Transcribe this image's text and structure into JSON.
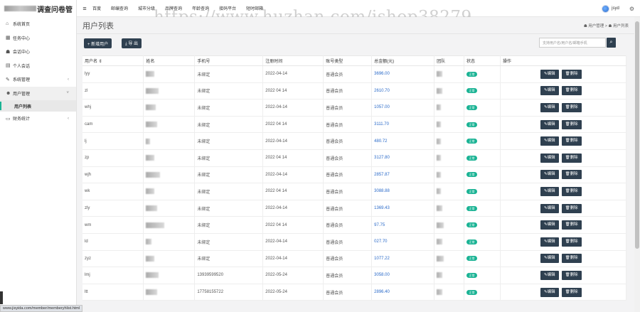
{
  "app": {
    "brand_suffix": "调查问卷管"
  },
  "sidebar": {
    "items": [
      {
        "icon": "⌂",
        "label": "系统首页",
        "icon_name": "home-icon"
      },
      {
        "icon": "▦",
        "label": "任务中心",
        "icon_name": "grid-icon"
      },
      {
        "icon": "☗",
        "label": "会话中心",
        "icon_name": "users-icon"
      },
      {
        "icon": "▤",
        "label": "个人会话",
        "icon_name": "list-icon"
      },
      {
        "icon": "✎",
        "label": "系统管理",
        "icon_name": "wrench-icon",
        "caret": "‹"
      },
      {
        "icon": "☻",
        "label": "用户管理",
        "icon_name": "user-group-icon",
        "caret": "˅"
      },
      {
        "icon": "",
        "label": "用户列表",
        "icon_name": "user-list-icon"
      },
      {
        "icon": "▭",
        "label": "财务统计",
        "icon_name": "wallet-icon",
        "caret": "‹"
      }
    ]
  },
  "topnav": {
    "items": [
      "百度",
      "邮编查询",
      "城市分级",
      "品牌查询",
      "年龄查询",
      "接码平台",
      "短时邮箱"
    ]
  },
  "user": {
    "name": "jsyd"
  },
  "watermark": "https://www.huzhan.com/ishop38279",
  "page": {
    "title": "用户列表",
    "breadcrumb": "☗ 用户管理 > ☗ 用户列表",
    "add_button": "+ 新增用户",
    "export_button": "⤓ 导 出",
    "search_placeholder": "支持用户名/用户名/邮箱手机",
    "search_button": "⌕"
  },
  "table": {
    "headers": [
      "用户名 ⇕",
      "姓名",
      "手机号",
      "注册时间",
      "账号类型",
      "总金额(元)",
      "团队",
      "状态",
      "操作"
    ],
    "edit_label": "✎编辑",
    "delete_label": "🗑删除",
    "status_label": "正常",
    "rows": [
      {
        "username": "lyy",
        "phone": "未绑定",
        "date": "2022-04-14",
        "type": "普通会员",
        "balance": "3696.00"
      },
      {
        "username": "zl",
        "phone": "未绑定",
        "date": "2022 04 14",
        "type": "普通会员",
        "balance": "2610.70"
      },
      {
        "username": "whj",
        "phone": "未绑定",
        "date": "2022-04-14",
        "type": "普通会员",
        "balance": "1057.00"
      },
      {
        "username": "cam",
        "phone": "未绑定",
        "date": "2022 04 14",
        "type": "普通会员",
        "balance": "3111.70"
      },
      {
        "username": "lj",
        "phone": "未绑定",
        "date": "2022-04-14",
        "type": "普通会员",
        "balance": "480.72"
      },
      {
        "username": "zp",
        "phone": "未绑定",
        "date": "2022 04 14",
        "type": "普通会员",
        "balance": "3127.80"
      },
      {
        "username": "wjh",
        "phone": "未绑定",
        "date": "2022-04-14",
        "type": "普通会员",
        "balance": "2857.87"
      },
      {
        "username": "wk",
        "phone": "未绑定",
        "date": "2022 04 14",
        "type": "普通会员",
        "balance": "3088.88"
      },
      {
        "username": "zly",
        "phone": "未绑定",
        "date": "2022-04-14",
        "type": "普通会员",
        "balance": "1369.43"
      },
      {
        "username": "wm",
        "phone": "未绑定",
        "date": "2022 04 14",
        "type": "普通会员",
        "balance": "97.75"
      },
      {
        "username": "ld",
        "phone": "未绑定",
        "date": "2022-04-14",
        "type": "普通会员",
        "balance": "027.70"
      },
      {
        "username": "zyz",
        "phone": "未绑定",
        "date": "2022-04-14",
        "type": "普通会员",
        "balance": "1077.22"
      },
      {
        "username": "lmj",
        "phone": "13939599520",
        "date": "2022-05-24",
        "type": "普通会员",
        "balance": "3058.00"
      },
      {
        "username": "ltt",
        "phone": "17758155722",
        "date": "2022-05-24",
        "type": "普通会员",
        "balance": "2896.40"
      }
    ]
  },
  "status_url": "www.jisyida.com/member/memberyhlist.html"
}
